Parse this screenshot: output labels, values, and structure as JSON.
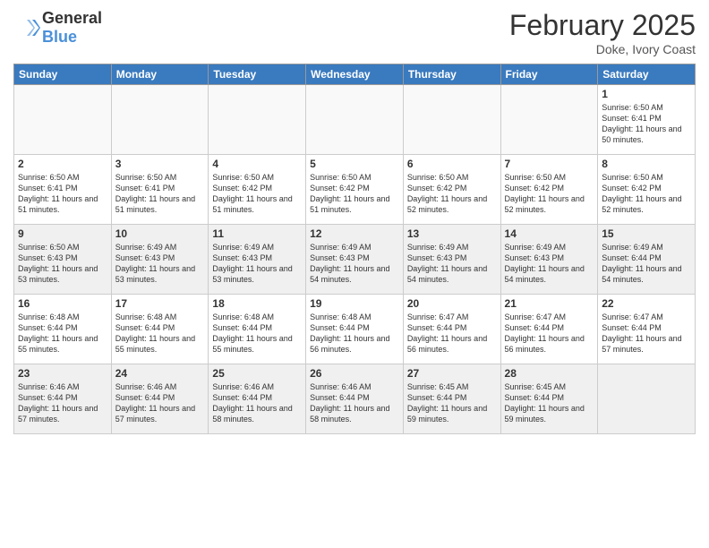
{
  "header": {
    "logo": {
      "general": "General",
      "blue": "Blue"
    },
    "title": "February 2025",
    "subtitle": "Doke, Ivory Coast"
  },
  "days_of_week": [
    "Sunday",
    "Monday",
    "Tuesday",
    "Wednesday",
    "Thursday",
    "Friday",
    "Saturday"
  ],
  "weeks": [
    {
      "alt": false,
      "days": [
        {
          "num": "",
          "info": ""
        },
        {
          "num": "",
          "info": ""
        },
        {
          "num": "",
          "info": ""
        },
        {
          "num": "",
          "info": ""
        },
        {
          "num": "",
          "info": ""
        },
        {
          "num": "",
          "info": ""
        },
        {
          "num": "1",
          "info": "Sunrise: 6:50 AM\nSunset: 6:41 PM\nDaylight: 11 hours\nand 50 minutes."
        }
      ]
    },
    {
      "alt": false,
      "days": [
        {
          "num": "2",
          "info": "Sunrise: 6:50 AM\nSunset: 6:41 PM\nDaylight: 11 hours\nand 51 minutes."
        },
        {
          "num": "3",
          "info": "Sunrise: 6:50 AM\nSunset: 6:41 PM\nDaylight: 11 hours\nand 51 minutes."
        },
        {
          "num": "4",
          "info": "Sunrise: 6:50 AM\nSunset: 6:42 PM\nDaylight: 11 hours\nand 51 minutes."
        },
        {
          "num": "5",
          "info": "Sunrise: 6:50 AM\nSunset: 6:42 PM\nDaylight: 11 hours\nand 51 minutes."
        },
        {
          "num": "6",
          "info": "Sunrise: 6:50 AM\nSunset: 6:42 PM\nDaylight: 11 hours\nand 52 minutes."
        },
        {
          "num": "7",
          "info": "Sunrise: 6:50 AM\nSunset: 6:42 PM\nDaylight: 11 hours\nand 52 minutes."
        },
        {
          "num": "8",
          "info": "Sunrise: 6:50 AM\nSunset: 6:42 PM\nDaylight: 11 hours\nand 52 minutes."
        }
      ]
    },
    {
      "alt": true,
      "days": [
        {
          "num": "9",
          "info": "Sunrise: 6:50 AM\nSunset: 6:43 PM\nDaylight: 11 hours\nand 53 minutes."
        },
        {
          "num": "10",
          "info": "Sunrise: 6:49 AM\nSunset: 6:43 PM\nDaylight: 11 hours\nand 53 minutes."
        },
        {
          "num": "11",
          "info": "Sunrise: 6:49 AM\nSunset: 6:43 PM\nDaylight: 11 hours\nand 53 minutes."
        },
        {
          "num": "12",
          "info": "Sunrise: 6:49 AM\nSunset: 6:43 PM\nDaylight: 11 hours\nand 54 minutes."
        },
        {
          "num": "13",
          "info": "Sunrise: 6:49 AM\nSunset: 6:43 PM\nDaylight: 11 hours\nand 54 minutes."
        },
        {
          "num": "14",
          "info": "Sunrise: 6:49 AM\nSunset: 6:43 PM\nDaylight: 11 hours\nand 54 minutes."
        },
        {
          "num": "15",
          "info": "Sunrise: 6:49 AM\nSunset: 6:44 PM\nDaylight: 11 hours\nand 54 minutes."
        }
      ]
    },
    {
      "alt": false,
      "days": [
        {
          "num": "16",
          "info": "Sunrise: 6:48 AM\nSunset: 6:44 PM\nDaylight: 11 hours\nand 55 minutes."
        },
        {
          "num": "17",
          "info": "Sunrise: 6:48 AM\nSunset: 6:44 PM\nDaylight: 11 hours\nand 55 minutes."
        },
        {
          "num": "18",
          "info": "Sunrise: 6:48 AM\nSunset: 6:44 PM\nDaylight: 11 hours\nand 55 minutes."
        },
        {
          "num": "19",
          "info": "Sunrise: 6:48 AM\nSunset: 6:44 PM\nDaylight: 11 hours\nand 56 minutes."
        },
        {
          "num": "20",
          "info": "Sunrise: 6:47 AM\nSunset: 6:44 PM\nDaylight: 11 hours\nand 56 minutes."
        },
        {
          "num": "21",
          "info": "Sunrise: 6:47 AM\nSunset: 6:44 PM\nDaylight: 11 hours\nand 56 minutes."
        },
        {
          "num": "22",
          "info": "Sunrise: 6:47 AM\nSunset: 6:44 PM\nDaylight: 11 hours\nand 57 minutes."
        }
      ]
    },
    {
      "alt": true,
      "days": [
        {
          "num": "23",
          "info": "Sunrise: 6:46 AM\nSunset: 6:44 PM\nDaylight: 11 hours\nand 57 minutes."
        },
        {
          "num": "24",
          "info": "Sunrise: 6:46 AM\nSunset: 6:44 PM\nDaylight: 11 hours\nand 57 minutes."
        },
        {
          "num": "25",
          "info": "Sunrise: 6:46 AM\nSunset: 6:44 PM\nDaylight: 11 hours\nand 58 minutes."
        },
        {
          "num": "26",
          "info": "Sunrise: 6:46 AM\nSunset: 6:44 PM\nDaylight: 11 hours\nand 58 minutes."
        },
        {
          "num": "27",
          "info": "Sunrise: 6:45 AM\nSunset: 6:44 PM\nDaylight: 11 hours\nand 59 minutes."
        },
        {
          "num": "28",
          "info": "Sunrise: 6:45 AM\nSunset: 6:44 PM\nDaylight: 11 hours\nand 59 minutes."
        },
        {
          "num": "",
          "info": ""
        }
      ]
    }
  ]
}
